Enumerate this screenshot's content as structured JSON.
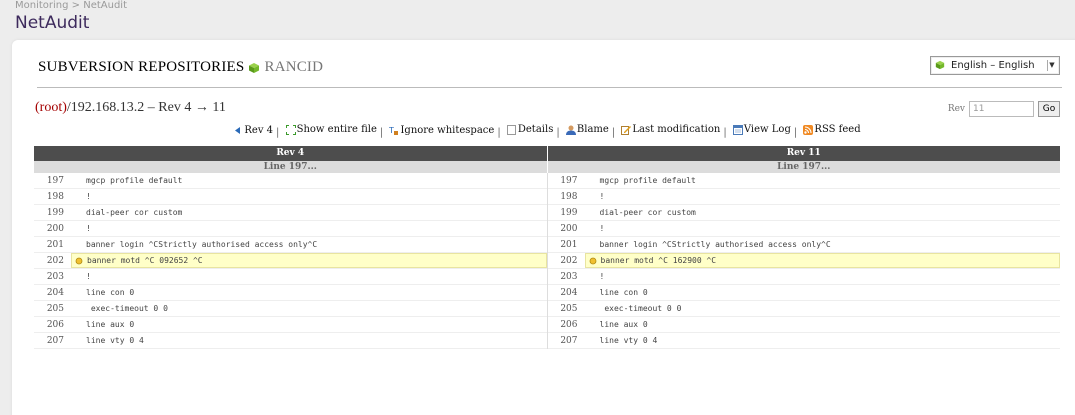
{
  "breadcrumb": "Monitoring > NetAudit",
  "app_title": "NetAudit",
  "repo": {
    "title": "SUBVERSION REPOSITORIES",
    "name": "RANCID"
  },
  "language": {
    "selected": "English – English"
  },
  "path": {
    "root": "(root)",
    "rest": "/192.168.13.2 – Rev 4 → 11"
  },
  "rev_box": {
    "label": "Rev",
    "value": "11",
    "go_label": "Go"
  },
  "nav": {
    "rev": "Rev 4",
    "show_entire": "Show entire file",
    "ignore_ws": "Ignore whitespace",
    "details": "Details",
    "blame": "Blame",
    "last_mod": "Last modification",
    "view_log": "View Log",
    "rss": "RSS feed"
  },
  "diff": {
    "left_head": "Rev 4",
    "right_head": "Rev 11",
    "left_sub": "Line 197...",
    "right_sub": "Line 197...",
    "left_rows": [
      {
        "ln": "197",
        "code": "mgcp profile default",
        "changed": false
      },
      {
        "ln": "198",
        "code": "!",
        "changed": false
      },
      {
        "ln": "199",
        "code": "dial-peer cor custom",
        "changed": false
      },
      {
        "ln": "200",
        "code": "!",
        "changed": false
      },
      {
        "ln": "201",
        "code": "banner login ^CStrictly authorised access only^C",
        "changed": false
      },
      {
        "ln": "202",
        "code": "banner motd ^C 092652 ^C",
        "changed": true
      },
      {
        "ln": "203",
        "code": "!",
        "changed": false
      },
      {
        "ln": "204",
        "code": "line con 0",
        "changed": false
      },
      {
        "ln": "205",
        "code": " exec-timeout 0 0",
        "changed": false
      },
      {
        "ln": "206",
        "code": "line aux 0",
        "changed": false
      },
      {
        "ln": "207",
        "code": "line vty 0 4",
        "changed": false
      }
    ],
    "right_rows": [
      {
        "ln": "197",
        "code": "mgcp profile default",
        "changed": false
      },
      {
        "ln": "198",
        "code": "!",
        "changed": false
      },
      {
        "ln": "199",
        "code": "dial-peer cor custom",
        "changed": false
      },
      {
        "ln": "200",
        "code": "!",
        "changed": false
      },
      {
        "ln": "201",
        "code": "banner login ^CStrictly authorised access only^C",
        "changed": false
      },
      {
        "ln": "202",
        "code": "banner motd ^C 162900 ^C",
        "changed": true
      },
      {
        "ln": "203",
        "code": "!",
        "changed": false
      },
      {
        "ln": "204",
        "code": "line con 0",
        "changed": false
      },
      {
        "ln": "205",
        "code": " exec-timeout 0 0",
        "changed": false
      },
      {
        "ln": "206",
        "code": "line aux 0",
        "changed": false
      },
      {
        "ln": "207",
        "code": "line vty 0 4",
        "changed": false
      }
    ]
  },
  "colors": {
    "accent_title": "#3d2a5c",
    "root_red": "#a40000",
    "header_bg": "#4d4d4d",
    "changed_bg": "#ffffc8"
  }
}
